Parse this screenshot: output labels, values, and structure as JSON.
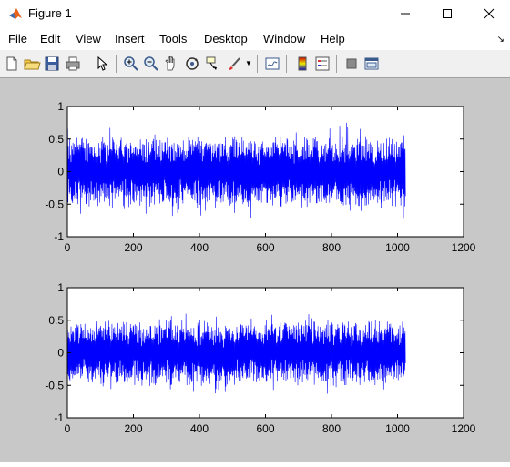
{
  "window": {
    "title": "Figure 1"
  },
  "menu": {
    "items": [
      "File",
      "Edit",
      "View",
      "Insert",
      "Tools",
      "Desktop",
      "Window",
      "Help"
    ]
  },
  "toolbar": {
    "icons": [
      "new-figure-icon",
      "open-file-icon",
      "save-icon",
      "print-icon",
      "pointer-icon",
      "zoom-in-icon",
      "zoom-out-icon",
      "pan-icon",
      "rotate-3d-icon",
      "data-cursor-icon",
      "brush-icon",
      "link-plot-icon",
      "colorbar-icon",
      "legend-icon",
      "hide-plot-tools-icon",
      "show-plot-tools-icon"
    ]
  },
  "colors": {
    "series": "#0000ff",
    "figure_bg": "#c8c8c8",
    "axes_bg": "#ffffff"
  },
  "chart_data": [
    {
      "type": "line",
      "title": "",
      "xlabel": "",
      "ylabel": "",
      "xlim": [
        0,
        1200
      ],
      "ylim": [
        -1,
        1
      ],
      "xticks": [
        0,
        200,
        400,
        600,
        800,
        1000,
        1200
      ],
      "yticks": [
        -1,
        -0.5,
        0,
        0.5,
        1
      ],
      "xtick_labels": [
        "0",
        "200",
        "400",
        "600",
        "800",
        "1000",
        "1200"
      ],
      "ytick_labels": [
        "-1",
        "-0.5",
        "0",
        "0.5",
        "1"
      ],
      "grid": false,
      "series": [
        {
          "color": "#0000ff",
          "x_range": [
            1,
            1024
          ],
          "sample_count": 1024,
          "envelope": {
            "max": 0.75,
            "min": -0.75,
            "typical_max": 0.5,
            "typical_min": -0.5
          }
        }
      ]
    },
    {
      "type": "line",
      "title": "",
      "xlabel": "",
      "ylabel": "",
      "xlim": [
        0,
        1200
      ],
      "ylim": [
        -1,
        1
      ],
      "xticks": [
        0,
        200,
        400,
        600,
        800,
        1000,
        1200
      ],
      "yticks": [
        -1,
        -0.5,
        0,
        0.5,
        1
      ],
      "xtick_labels": [
        "0",
        "200",
        "400",
        "600",
        "800",
        "1000",
        "1200"
      ],
      "ytick_labels": [
        "-1",
        "-0.5",
        "0",
        "0.5",
        "1"
      ],
      "grid": false,
      "series": [
        {
          "color": "#0000ff",
          "x_range": [
            1,
            1024
          ],
          "sample_count": 1024,
          "envelope": {
            "max": 0.6,
            "min": -0.65,
            "typical_max": 0.45,
            "typical_min": -0.45
          }
        }
      ]
    }
  ]
}
